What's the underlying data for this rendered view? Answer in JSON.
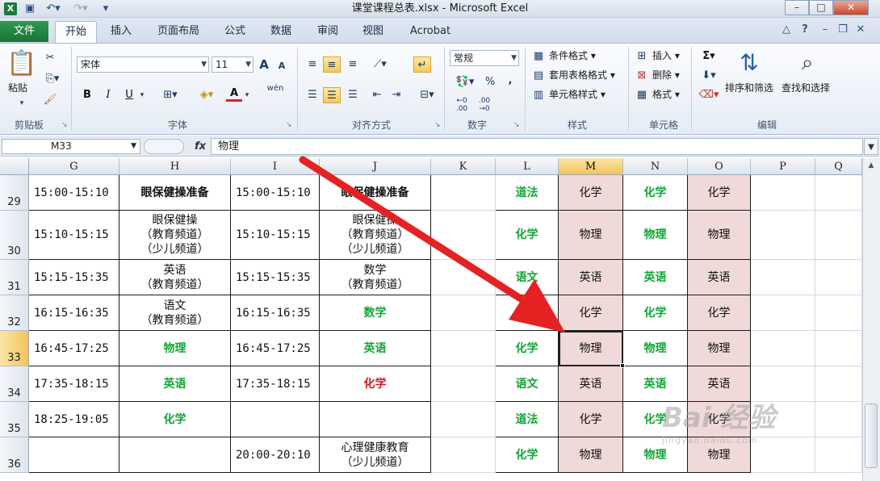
{
  "window": {
    "title": "课堂课程总表.xlsx - Microsoft Excel",
    "app_icon": "X"
  },
  "tabs": [
    "文件",
    "开始",
    "插入",
    "页面布局",
    "公式",
    "数据",
    "审阅",
    "视图",
    "Acrobat"
  ],
  "ribbon": {
    "clipboard": {
      "paste": "粘贴",
      "group": "剪贴板"
    },
    "font": {
      "name": "宋体",
      "size": "11",
      "group": "字体",
      "bold": "B",
      "italic": "I",
      "underline": "U",
      "grow": "A",
      "shrink": "A",
      "font_color": "A",
      "phonetic": "wén"
    },
    "align": {
      "group": "对齐方式"
    },
    "number": {
      "format": "常规",
      "group": "数字",
      "percent": "%",
      "comma": ","
    },
    "styles": {
      "cond": "条件格式",
      "table": "套用表格格式",
      "cell": "单元格样式",
      "group": "样式"
    },
    "cells": {
      "insert": "插入",
      "delete": "删除",
      "format": "格式",
      "group": "单元格"
    },
    "editing": {
      "sum": "Σ",
      "sort": "排序和筛选",
      "find": "查找和选择",
      "group": "编辑"
    }
  },
  "formula_bar": {
    "name_box": "M33",
    "fx": "fx",
    "content": "物理"
  },
  "columns": [
    "G",
    "H",
    "I",
    "J",
    "K",
    "L",
    "M",
    "N",
    "O",
    "P",
    "Q"
  ],
  "rows": [
    {
      "num": "29",
      "G": "15:00-15:10",
      "H": "眼保健操准备",
      "I": "15:00-15:10",
      "J": "眼保健操准备",
      "K": "",
      "L": "道法",
      "M": "化学",
      "N": "化学",
      "O": "化学"
    },
    {
      "num": "30",
      "G": "15:10-15:15",
      "H": "眼保健操\n（教育频道）\n（少儿频道）",
      "I": "15:10-15:15",
      "J": "眼保健操\n（教育频道）\n（少儿频道）",
      "K": "",
      "L": "化学",
      "M": "物理",
      "N": "物理",
      "O": "物理"
    },
    {
      "num": "31",
      "G": "15:15-15:35",
      "H": "英语\n（教育频道）",
      "I": "15:15-15:35",
      "J": "数学\n（教育频道）",
      "K": "",
      "L": "语文",
      "M": "英语",
      "N": "英语",
      "O": "英语"
    },
    {
      "num": "32",
      "G": "16:15-16:35",
      "H": "语文\n（教育频道）",
      "I": "16:15-16:35",
      "J": "数学",
      "K": "",
      "L": "",
      "M": "化学",
      "N": "化学",
      "O": "化学"
    },
    {
      "num": "33",
      "G": "16:45-17:25",
      "H": "物理",
      "I": "16:45-17:25",
      "J": "英语",
      "K": "",
      "L": "化学",
      "M": "物理",
      "N": "物理",
      "O": "物理"
    },
    {
      "num": "34",
      "G": "17:35-18:15",
      "H": "英语",
      "I": "17:35-18:15",
      "J": "化学",
      "K": "",
      "L": "语文",
      "M": "英语",
      "N": "英语",
      "O": "英语"
    },
    {
      "num": "35",
      "G": "18:25-19:05",
      "H": "化学",
      "I": "",
      "J": "",
      "K": "",
      "L": "道法",
      "M": "化学",
      "N": "化学",
      "O": "化学"
    },
    {
      "num": "36",
      "G": "",
      "H": "",
      "I": "20:00-20:10",
      "J": "心理健康教育\n（少儿频道）",
      "K": "",
      "L": "化学",
      "M": "物理",
      "N": "物理",
      "O": "物理"
    }
  ],
  "watermark": "Bai 经验",
  "watermark_url": "jingyan.baidu.com",
  "colors": {
    "accent_green": "#13a537",
    "accent_red": "#d31b1b",
    "pink_fill": "#f0d9d9",
    "arrow": "#e52222"
  }
}
